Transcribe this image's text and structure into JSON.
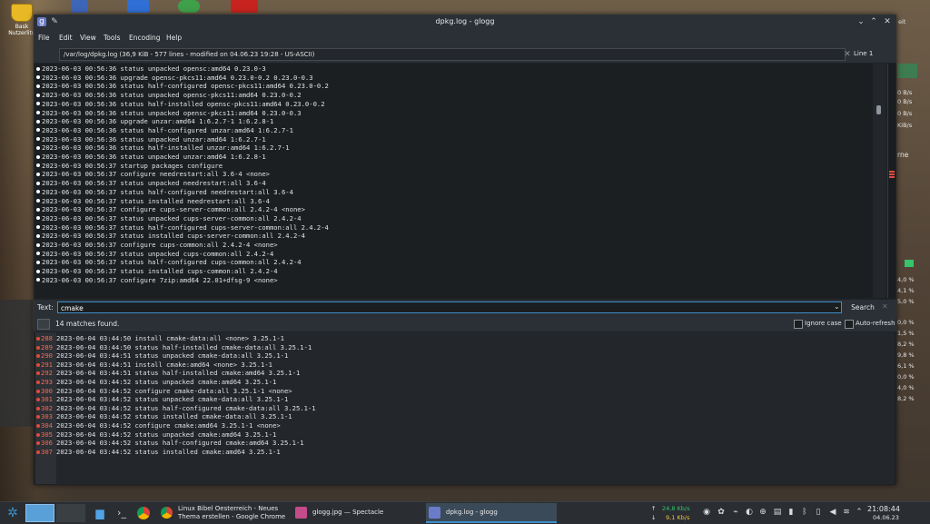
{
  "colors": {
    "accent": "#3d8ec9",
    "match_line_number": "#f26b5b",
    "match_marker": "#e14a3b",
    "net_up": "#37c46b",
    "net_down": "#f0c040"
  },
  "desktop": {
    "icon_label_line1": "Bask",
    "icon_label_line2": "Nutzerlitu",
    "widget_text_top": "eit",
    "widget_net": [
      "0 B/s",
      "0 B/s",
      "0 B/s",
      "KiB/s"
    ],
    "widget_percent": [
      "4,0 %",
      "4,1 %",
      "5,0 %",
      "0,0 %",
      "1,5 %",
      "8,2 %",
      "9,8 %",
      "6,1 %",
      "0,0 %",
      "4,0 %",
      "8,2 %"
    ],
    "widget_rne": "rne"
  },
  "window": {
    "title": "dpkg.log - glogg",
    "menu": [
      "File",
      "Edit",
      "View",
      "Tools",
      "Encoding",
      "Help"
    ],
    "file_info": "/var/log/dpkg.log (36,9 KiB - 577 lines - modified on 04.06.23 19:28 - US-ASCII)",
    "line_indicator": "Line 1",
    "log_lines": [
      "2023-06-03 00:56:36 status unpacked opensc:amd64 0.23.0-3",
      "2023-06-03 00:56:36 upgrade opensc-pkcs11:amd64 0.23.0-0.2 0.23.0-0.3",
      "2023-06-03 00:56:36 status half-configured opensc-pkcs11:amd64 0.23.0-0.2",
      "2023-06-03 00:56:36 status unpacked opensc-pkcs11:amd64 0.23.0-0.2",
      "2023-06-03 00:56:36 status half-installed opensc-pkcs11:amd64 0.23.0-0.2",
      "2023-06-03 00:56:36 status unpacked opensc-pkcs11:amd64 0.23.0-0.3",
      "2023-06-03 00:56:36 upgrade unzar:amd64 1:6.2.7-1 1:6.2.8-1",
      "2023-06-03 00:56:36 status half-configured unzar:amd64 1:6.2.7-1",
      "2023-06-03 00:56:36 status unpacked unzar:amd64 1:6.2.7-1",
      "2023-06-03 00:56:36 status half-installed unzar:amd64 1:6.2.7-1",
      "2023-06-03 00:56:36 status unpacked unzar:amd64 1:6.2.8-1",
      "2023-06-03 00:56:37 startup packages configure",
      "2023-06-03 00:56:37 configure needrestart:all 3.6-4 <none>",
      "2023-06-03 00:56:37 status unpacked needrestart:all 3.6-4",
      "2023-06-03 00:56:37 status half-configured needrestart:all 3.6-4",
      "2023-06-03 00:56:37 status installed needrestart:all 3.6-4",
      "2023-06-03 00:56:37 configure cups-server-common:all 2.4.2-4 <none>",
      "2023-06-03 00:56:37 status unpacked cups-server-common:all 2.4.2-4",
      "2023-06-03 00:56:37 status half-configured cups-server-common:all 2.4.2-4",
      "2023-06-03 00:56:37 status installed cups-server-common:all 2.4.2-4",
      "2023-06-03 00:56:37 configure cups-common:all 2.4.2-4 <none>",
      "2023-06-03 00:56:37 status unpacked cups-common:all 2.4.2-4",
      "2023-06-03 00:56:37 status half-configured cups-common:all 2.4.2-4",
      "2023-06-03 00:56:37 status installed cups-common:all 2.4.2-4",
      "2023-06-03 00:56:37 configure 7zip:amd64 22.01+dfsg-9 <none>"
    ],
    "search": {
      "label": "Text:",
      "value": "cmake",
      "button": "Search",
      "matches": "14 matches found.",
      "ignore_case": "Ignore case",
      "auto_refresh": "Auto-refresh"
    },
    "filtered_lines": [
      {
        "ln": "288",
        "text": "2023-06-04 03:44:50 install cmake-data:all <none> 3.25.1-1"
      },
      {
        "ln": "289",
        "text": "2023-06-04 03:44:50 status half-installed cmake-data:all 3.25.1-1"
      },
      {
        "ln": "290",
        "text": "2023-06-04 03:44:51 status unpacked cmake-data:all 3.25.1-1"
      },
      {
        "ln": "291",
        "text": "2023-06-04 03:44:51 install cmake:amd64 <none> 3.25.1-1"
      },
      {
        "ln": "292",
        "text": "2023-06-04 03:44:51 status half-installed cmake:amd64 3.25.1-1"
      },
      {
        "ln": "293",
        "text": "2023-06-04 03:44:52 status unpacked cmake:amd64 3.25.1-1"
      },
      {
        "ln": "300",
        "text": "2023-06-04 03:44:52 configure cmake-data:all 3.25.1-1 <none>"
      },
      {
        "ln": "301",
        "text": "2023-06-04 03:44:52 status unpacked cmake-data:all 3.25.1-1"
      },
      {
        "ln": "302",
        "text": "2023-06-04 03:44:52 status half-configured cmake-data:all 3.25.1-1"
      },
      {
        "ln": "303",
        "text": "2023-06-04 03:44:52 status installed cmake-data:all 3.25.1-1"
      },
      {
        "ln": "304",
        "text": "2023-06-04 03:44:52 configure cmake:amd64 3.25.1-1 <none>"
      },
      {
        "ln": "305",
        "text": "2023-06-04 03:44:52 status unpacked cmake:amd64 3.25.1-1"
      },
      {
        "ln": "306",
        "text": "2023-06-04 03:44:52 status half-configured cmake:amd64 3.25.1-1"
      },
      {
        "ln": "307",
        "text": "2023-06-04 03:44:52 status installed cmake:amd64 3.25.1-1"
      }
    ]
  },
  "taskbar": {
    "tasks": [
      {
        "label": "Linux Bibel Oesterreich - Neues\nThema erstellen - Google Chrome",
        "icon": "chrome-icon"
      },
      {
        "label": "glogg.jpg — Spectacle",
        "icon": "spectacle-icon"
      },
      {
        "label": "dpkg.log - glogg",
        "icon": "glogg-icon"
      }
    ],
    "net_up": "24,8 Kb/s",
    "net_down": "9,1 Kb/s",
    "clock": "21:08:44",
    "date": "04.06.23"
  }
}
